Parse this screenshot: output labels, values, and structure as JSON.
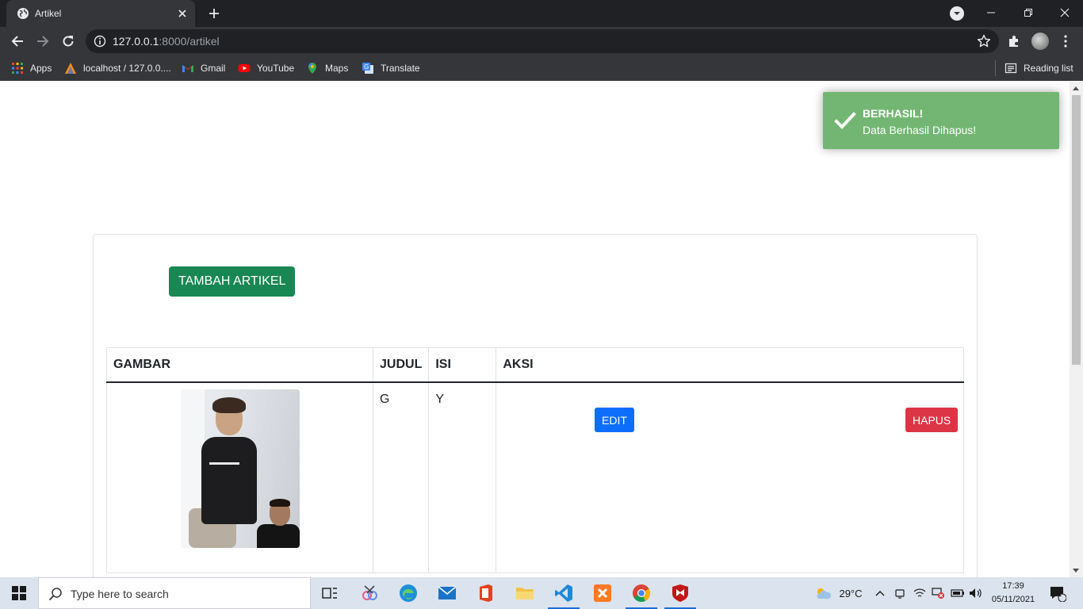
{
  "browser": {
    "tab_title": "Artikel",
    "url_host": "127.0.0.1",
    "url_rest": ":8000/artikel",
    "bookmarks": [
      {
        "label": "Apps",
        "icon": "apps-grid-icon"
      },
      {
        "label": "localhost / 127.0.0....",
        "icon": "phpmyadmin-icon"
      },
      {
        "label": "Gmail",
        "icon": "gmail-icon"
      },
      {
        "label": "YouTube",
        "icon": "youtube-icon"
      },
      {
        "label": "Maps",
        "icon": "maps-icon"
      },
      {
        "label": "Translate",
        "icon": "translate-icon"
      }
    ],
    "reading_list": "Reading list"
  },
  "page": {
    "add_button": "TAMBAH ARTIKEL",
    "table": {
      "headers": [
        "GAMBAR",
        "JUDUL",
        "ISI",
        "AKSI"
      ],
      "rows": [
        {
          "judul": "G",
          "isi": "Y",
          "edit": "EDIT",
          "hapus": "HAPUS"
        }
      ]
    },
    "toast": {
      "title": "BERHASIL!",
      "message": "Data Berhasil Dihapus!"
    }
  },
  "taskbar": {
    "search_placeholder": "Type here to search",
    "temperature": "29°C",
    "time": "17:39",
    "date": "05/11/2021",
    "notification_count": "1"
  },
  "colors": {
    "success": "#198754",
    "primary": "#0d6efd",
    "danger": "#dc3545",
    "toast": "#73b673"
  }
}
